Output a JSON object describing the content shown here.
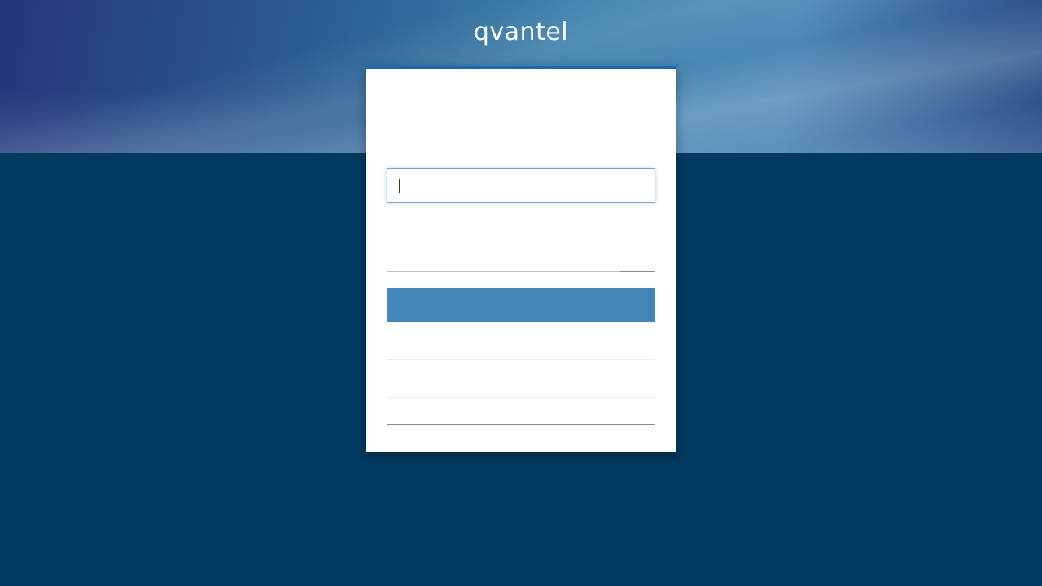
{
  "header": {
    "logo_text": "qvantel"
  },
  "colors": {
    "background": "#003a60",
    "card_accent": "#1469b8",
    "primary_button": "#4287b7"
  },
  "login_form": {
    "username_value": "",
    "password_value": "",
    "submit_label": "",
    "alt_button_label": ""
  }
}
